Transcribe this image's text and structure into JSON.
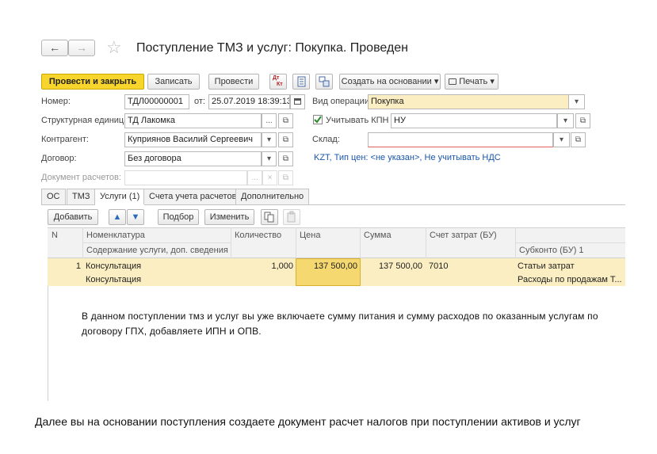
{
  "header": {
    "title": "Поступление ТМЗ и услуг: Покупка. Проведен",
    "back_icon": "←",
    "forward_icon": "→",
    "star_icon": "☆"
  },
  "toolbar": {
    "post_close": "Провести и закрыть",
    "write": "Записать",
    "post": "Провести",
    "dt_kt_top": "Дт",
    "dt_kt_bottom": "Кт",
    "create_based": "Создать на основании",
    "print": "Печать",
    "dropdown_arrow": "▾"
  },
  "form": {
    "number_label": "Номер:",
    "number_value": "ТДЛ00000001",
    "from_label": "от:",
    "date_value": "25.07.2019 18:39:13",
    "operation_label": "Вид операции:",
    "operation_value": "Покупка",
    "unit_label": "Структурная единица:",
    "unit_value": "ТД Лакомка",
    "kpn_label": "Учитывать КПН",
    "kpn_value": "НУ",
    "contractor_label": "Контрагент:",
    "contractor_value": "Куприянов Василий Сергеевич",
    "warehouse_label": "Склад:",
    "warehouse_value": "",
    "contract_label": "Договор:",
    "contract_value": "Без договора",
    "price_link": "KZT, Тип цен: <не указан>, Не учитывать НДС",
    "settlement_doc_label": "Документ расчетов:",
    "settlement_doc_value": "",
    "ellipsis": "...",
    "open_icon": "⧉",
    "clear_icon": "×",
    "dropdown_arrow": "▾"
  },
  "tabs": [
    "ОС",
    "ТМЗ",
    "Услуги (1)",
    "Счета учета расчетов",
    "Дополнительно"
  ],
  "tab_toolbar": {
    "add": "Добавить",
    "up_icon": "▲",
    "down_icon": "▼",
    "select": "Подбор",
    "change": "Изменить"
  },
  "table": {
    "headers": {
      "n": "N",
      "nomenclature": "Номенклатура",
      "content": "Содержание услуги, доп. сведения",
      "quantity": "Количество",
      "price": "Цена",
      "sum": "Сумма",
      "cost_account": "Счет затрат (БУ)",
      "subconto": "Субконто (БУ) 1"
    },
    "row": {
      "n": "1",
      "nomenclature": "Консультация",
      "content": "Консультация",
      "quantity": "1,000",
      "price": "137 500,00",
      "sum": "137 500,00",
      "cost_account": "7010",
      "subconto_1": "Статьи затрат",
      "subconto_2": "Расходы по продажам Т..."
    }
  },
  "annotation": "В данном поступлении тмз и услуг вы уже включаете сумму питания и сумму расходов по оказанным услугам по договору ГПХ, добавляете ИПН и ОПВ.",
  "caption": "Далее вы на основании поступления создаете документ расчет налогов при поступлении активов и услуг"
}
